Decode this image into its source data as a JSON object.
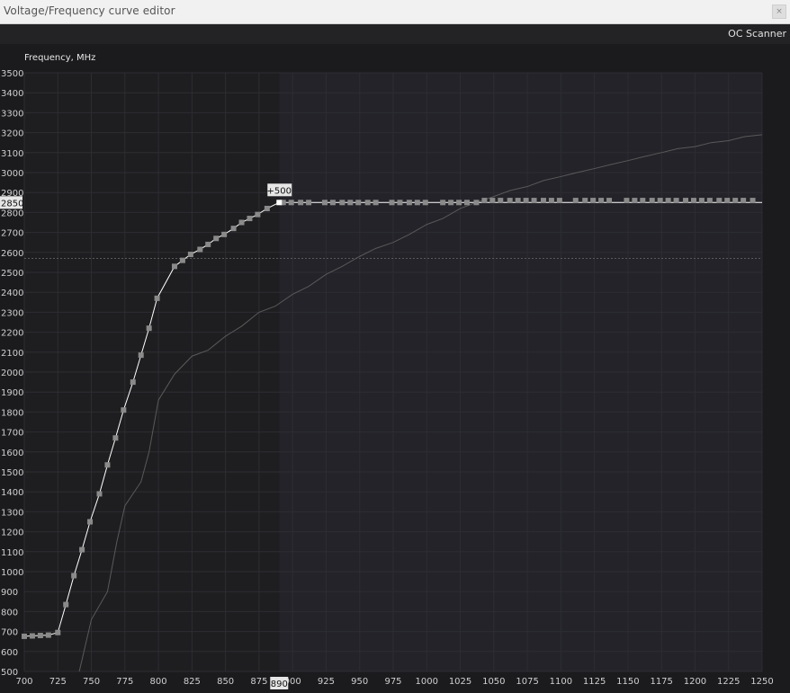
{
  "window": {
    "title": "Voltage/Frequency curve editor",
    "close_icon": "close-icon"
  },
  "toolbar": {
    "oc_scanner_label": "OC Scanner"
  },
  "colors": {
    "background": "#1b1b1e",
    "locked_region": "#1e1e20",
    "unlocked_region": "#232329",
    "grid": "#2d2d33",
    "curve": "#ffffff",
    "points": "#8a8a8a",
    "default_curve": "#5a5a5a",
    "limit_line": "#ffffff",
    "dotted_line": "#5a5a5a"
  },
  "chart_data": {
    "type": "line",
    "ylabel": "Frequency, MHz",
    "xlim": [
      700,
      1250
    ],
    "ylim": [
      500,
      3500
    ],
    "x_ticks": [
      700,
      725,
      750,
      775,
      800,
      825,
      850,
      875,
      900,
      925,
      950,
      975,
      1000,
      1025,
      1050,
      1075,
      1100,
      1125,
      1150,
      1175,
      1200,
      1225,
      1250
    ],
    "y_ticks": [
      500,
      600,
      700,
      800,
      900,
      1000,
      1100,
      1200,
      1300,
      1400,
      1500,
      1600,
      1700,
      1800,
      1900,
      2000,
      2100,
      2200,
      2300,
      2400,
      2500,
      2600,
      2700,
      2800,
      2900,
      3000,
      3100,
      3200,
      3300,
      3400,
      3500
    ],
    "grid": true,
    "selected_point": {
      "voltage": 890,
      "frequency": 2850,
      "offset_label": "+500",
      "x_label": "890",
      "y_label": "2850"
    },
    "reference_line_frequency": 2570,
    "limit_line_frequency": 2850,
    "series": [
      {
        "role": "edited-curve",
        "x": [
          700,
          706,
          712,
          718,
          725,
          731,
          737,
          743,
          749,
          756,
          762,
          768,
          774,
          781,
          787,
          793,
          799,
          812,
          818,
          824,
          831,
          837,
          843,
          849,
          856,
          862,
          868,
          874,
          881,
          890
        ],
        "y": [
          676,
          678,
          680,
          682,
          695,
          835,
          980,
          1110,
          1250,
          1390,
          1535,
          1670,
          1810,
          1950,
          2085,
          2220,
          2370,
          2530,
          2560,
          2590,
          2615,
          2640,
          2670,
          2690,
          2720,
          2750,
          2770,
          2790,
          2820,
          2850
        ]
      },
      {
        "role": "default-curve",
        "x": [
          741,
          750,
          762,
          769,
          775,
          787,
          793,
          800,
          812,
          825,
          837,
          850,
          862,
          875,
          887,
          900,
          912,
          925,
          937,
          950,
          962,
          975,
          987,
          1000,
          1012,
          1025,
          1037,
          1050,
          1062,
          1075,
          1087,
          1100,
          1112,
          1125,
          1137,
          1150,
          1162,
          1175,
          1187,
          1200,
          1212,
          1225,
          1237,
          1250
        ],
        "y": [
          500,
          760,
          900,
          1150,
          1330,
          1450,
          1600,
          1860,
          1990,
          2080,
          2110,
          2180,
          2230,
          2300,
          2330,
          2390,
          2430,
          2490,
          2530,
          2580,
          2620,
          2650,
          2690,
          2740,
          2770,
          2820,
          2850,
          2880,
          2910,
          2930,
          2960,
          2980,
          3000,
          3020,
          3040,
          3060,
          3080,
          3100,
          3120,
          3130,
          3150,
          3160,
          3180,
          3190
        ]
      },
      {
        "role": "locked-points",
        "x": [
          893,
          899,
          906,
          912,
          924,
          930,
          937,
          943,
          949,
          956,
          962,
          974,
          980,
          987,
          993,
          999,
          1012,
          1018,
          1024,
          1030,
          1037,
          1043,
          1049,
          1055,
          1062,
          1068,
          1074,
          1080,
          1087,
          1093,
          1099,
          1111,
          1118,
          1124,
          1130,
          1136,
          1149,
          1155,
          1161,
          1168,
          1174,
          1180,
          1186,
          1193,
          1199,
          1205,
          1211,
          1218,
          1224,
          1230,
          1236,
          1243
        ],
        "y": [
          2850,
          2850,
          2850,
          2850,
          2850,
          2850,
          2850,
          2850,
          2850,
          2850,
          2850,
          2850,
          2850,
          2850,
          2850,
          2850,
          2850,
          2850,
          2850,
          2850,
          2850,
          2860,
          2860,
          2860,
          2860,
          2860,
          2860,
          2860,
          2860,
          2860,
          2860,
          2860,
          2860,
          2860,
          2860,
          2860,
          2860,
          2860,
          2860,
          2860,
          2860,
          2860,
          2860,
          2860,
          2860,
          2860,
          2860,
          2860,
          2860,
          2860,
          2860,
          2860
        ]
      }
    ]
  }
}
